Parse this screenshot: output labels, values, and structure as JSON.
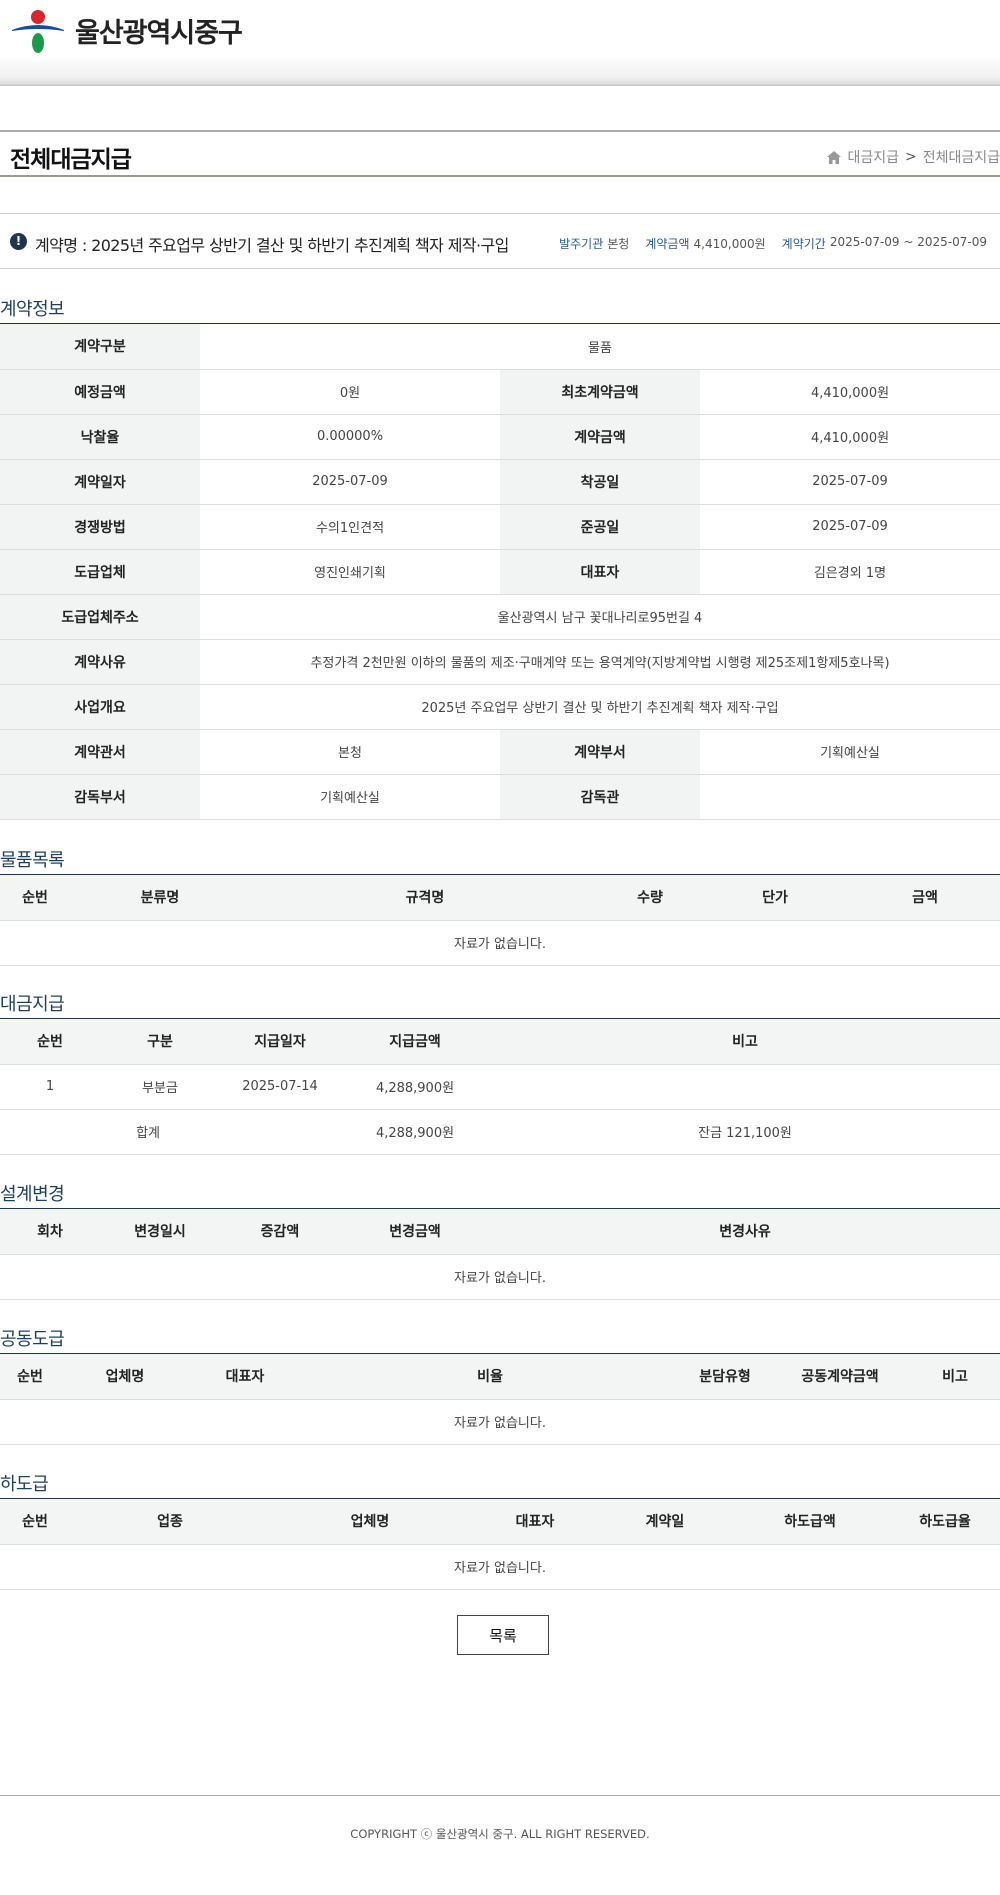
{
  "header": {
    "site_name": "울산광역시중구"
  },
  "title_bar": {
    "page_title": "전체대금지급",
    "breadcrumb": [
      "대금지급",
      "전체대금지급"
    ],
    "breadcrumb_sep": ">"
  },
  "contract": {
    "name": "계약명 : 2025년 주요업무 상반기 결산 및 하반기 추진계획 책자 제작·구입",
    "agency_label": "발주기관",
    "agency": "본청",
    "amount_label": "계약금액",
    "amount": "4,410,000원",
    "period_label": "계약기간",
    "period": "2025-07-09 ~ 2025-07-09"
  },
  "contract_info": {
    "title": "계약정보",
    "rows": [
      {
        "k1": "계약구분",
        "v1": "물품"
      },
      {
        "k1": "예정금액",
        "v1": "0원",
        "k2": "최초계약금액",
        "v2": "4,410,000원"
      },
      {
        "k1": "낙찰율",
        "v1": "0.00000%",
        "k2": "계약금액",
        "v2": "4,410,000원"
      },
      {
        "k1": "계약일자",
        "v1": "2025-07-09",
        "k2": "착공일",
        "v2": "2025-07-09"
      },
      {
        "k1": "경쟁방법",
        "v1": "수의1인견적",
        "k2": "준공일",
        "v2": "2025-07-09"
      },
      {
        "k1": "도급업체",
        "v1": "영진인쇄기획",
        "k2": "대표자",
        "v2": "김은경외 1명"
      },
      {
        "k1": "도급업체주소",
        "v1": "울산광역시 남구 꽃대나리로95번길 4"
      },
      {
        "k1": "계약사유",
        "v1": "추정가격 2천만원 이하의 물품의 제조·구매계약 또는 용역계약(지방계약법 시행령 제25조제1항제5호나목)"
      },
      {
        "k1": "사업개요",
        "v1": "2025년 주요업무 상반기 결산 및 하반기 추진계획 책자 제작·구입"
      },
      {
        "k1": "계약관서",
        "v1": "본청",
        "k2": "계약부서",
        "v2": "기획예산실"
      },
      {
        "k1": "감독부서",
        "v1": "기획예산실",
        "k2": "감독관",
        "v2": ""
      }
    ]
  },
  "goods": {
    "title": "물품목록",
    "headers": [
      "순번",
      "분류명",
      "규격명",
      "수량",
      "단가",
      "금액"
    ],
    "empty": "자료가 없습니다."
  },
  "payment": {
    "title": "대금지급",
    "headers": [
      "순번",
      "구분",
      "지급일자",
      "지급금액",
      "비고"
    ],
    "rows": [
      {
        "no": "1",
        "type": "부분금",
        "date": "2025-07-14",
        "amount": "4,288,900원",
        "note": ""
      }
    ],
    "total": {
      "label": "합계",
      "amount": "4,288,900원",
      "note": "잔금 121,100원"
    }
  },
  "design_change": {
    "title": "설계변경",
    "headers": [
      "회차",
      "변경일시",
      "증감액",
      "변경금액",
      "변경사유"
    ],
    "empty": "자료가 없습니다."
  },
  "joint": {
    "title": "공동도급",
    "headers": [
      "순번",
      "업체명",
      "대표자",
      "비율",
      "분담유형",
      "공동계약금액",
      "비고"
    ],
    "empty": "자료가 없습니다."
  },
  "sub": {
    "title": "하도급",
    "headers": [
      "순번",
      "업종",
      "업체명",
      "대표자",
      "계약일",
      "하도급액",
      "하도급율"
    ],
    "empty": "자료가 없습니다."
  },
  "buttons": {
    "list": "목록"
  },
  "footer": {
    "copyright": "COPYRIGHT ⓒ 울산광역시 중구. ALL RIGHT RESERVED."
  },
  "colors": {
    "accent": "#1f3550",
    "header_cell": "#f2f4f4"
  }
}
